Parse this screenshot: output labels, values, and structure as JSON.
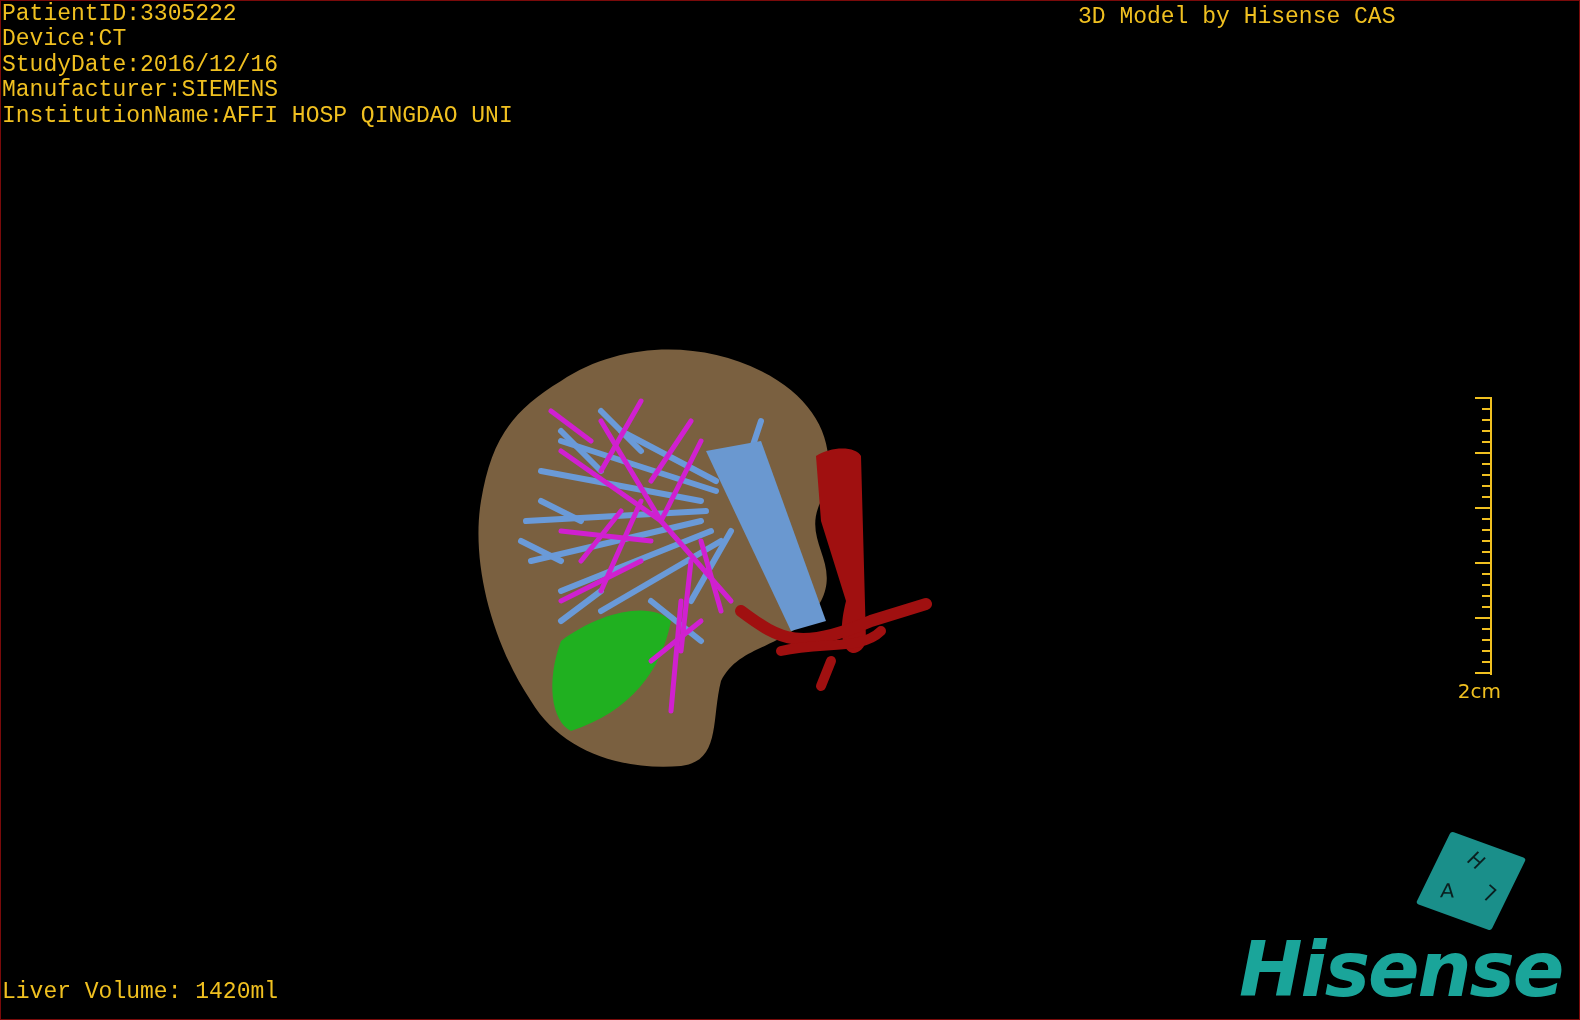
{
  "patient_info": [
    "PatientID:3305222",
    "Device:CT",
    "StudyDate:2016/12/16",
    "Manufacturer:SIEMENS",
    "InstitutionName:AFFI HOSP QINGDAO UNI"
  ],
  "title": "3D Model by Hisense CAS",
  "scale": {
    "label": "2cm"
  },
  "orientation_cube": {
    "labels": [
      "H",
      "A",
      "L"
    ]
  },
  "logo": "Hisense",
  "liver_volume": "Liver Volume: 1420ml"
}
